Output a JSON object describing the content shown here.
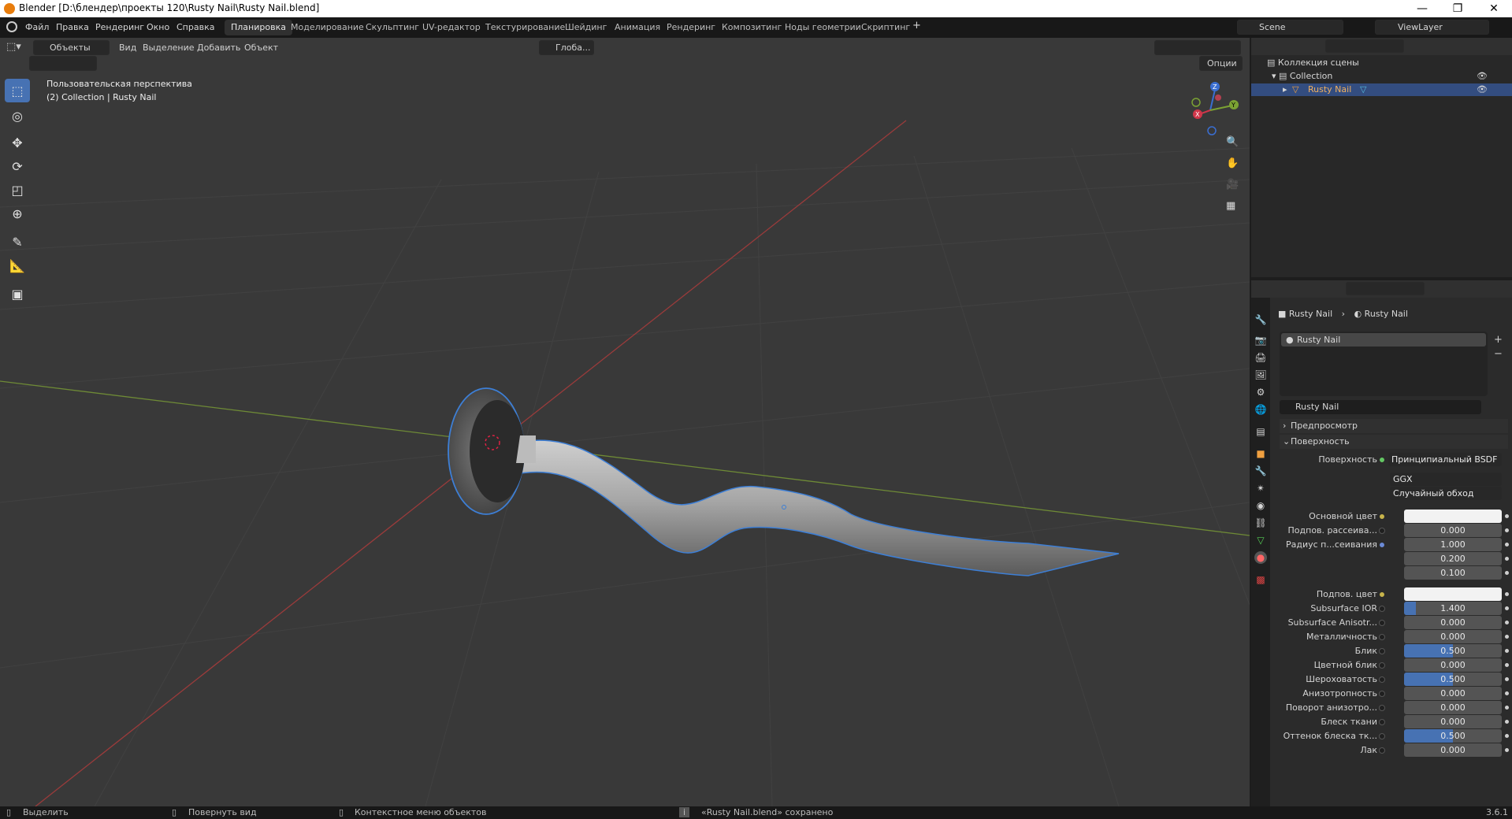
{
  "window": {
    "title": "Blender [D:\\блендер\\проекты 120\\Rusty Nail\\Rusty Nail.blend]",
    "minimize": "—",
    "restore": "❐",
    "close": "✕"
  },
  "menu": [
    "Файл",
    "Правка",
    "Рендеринг",
    "Окно",
    "Справка"
  ],
  "workspaces": [
    "Планировка",
    "Моделирование",
    "Скульптинг",
    "UV-редактор",
    "Текстурирование",
    "Шейдинг",
    "Анимация",
    "Рендеринг",
    "Композитинг",
    "Ноды геометрии",
    "Скриптинг"
  ],
  "active_workspace": "Планировка",
  "scene": {
    "name": "Scene",
    "view_layer": "ViewLayer"
  },
  "viewport": {
    "mode": "Объекты",
    "menus": [
      "Вид",
      "Выделение",
      "Добавить",
      "Объект"
    ],
    "transform_orientation": "Глоба...",
    "options": "Опции",
    "perspective_label": "Пользовательская перспектива",
    "collection_label": "(2) Collection | Rusty Nail",
    "gizmo": {
      "z": "Z",
      "y": "Y",
      "x": "X"
    }
  },
  "outliner": {
    "root": "Коллекция сцены",
    "collection": "Collection",
    "object": "Rusty Nail"
  },
  "properties": {
    "breadcrumb_object": "Rusty Nail",
    "breadcrumb_material": "Rusty Nail",
    "material_slot": "Rusty Nail",
    "material_name": "Rusty Nail",
    "panel_preview": "Предпросмотр",
    "panel_surface": "Поверхность",
    "surface_label": "Поверхность",
    "surface_value": "Принципиальный BSDF",
    "distribution": "GGX",
    "subsurface_method": "Случайный обход",
    "rows": [
      {
        "label": "Основной цвет",
        "value": "",
        "type": "color",
        "dot": "y"
      },
      {
        "label": "Подпов. рассеива...",
        "value": "0.000",
        "fill": 0,
        "dot": "n"
      },
      {
        "label": "Радиус п...сеивания",
        "value": "1.000",
        "fill": 0,
        "dot": "b"
      },
      {
        "label": "",
        "value": "0.200",
        "fill": 0,
        "dot": ""
      },
      {
        "label": "",
        "value": "0.100",
        "fill": 0,
        "dot": ""
      },
      {
        "label": "Подпов. цвет",
        "value": "",
        "type": "color",
        "dot": "y"
      },
      {
        "label": "Subsurface IOR",
        "value": "1.400",
        "fill": 0.12,
        "dot": "n"
      },
      {
        "label": "Subsurface Anisotr...",
        "value": "0.000",
        "fill": 0,
        "dot": "n"
      },
      {
        "label": "Металличность",
        "value": "0.000",
        "fill": 0,
        "dot": "n"
      },
      {
        "label": "Блик",
        "value": "0.500",
        "fill": 0.5,
        "dot": "n"
      },
      {
        "label": "Цветной блик",
        "value": "0.000",
        "fill": 0,
        "dot": "n"
      },
      {
        "label": "Шероховатость",
        "value": "0.500",
        "fill": 0.5,
        "dot": "n"
      },
      {
        "label": "Анизотропность",
        "value": "0.000",
        "fill": 0,
        "dot": "n"
      },
      {
        "label": "Поворот анизотро...",
        "value": "0.000",
        "fill": 0,
        "dot": "n"
      },
      {
        "label": "Блеск ткани",
        "value": "0.000",
        "fill": 0,
        "dot": "n"
      },
      {
        "label": "Оттенок блеска тк...",
        "value": "0.500",
        "fill": 0.5,
        "dot": "n"
      },
      {
        "label": "Лак",
        "value": "0.000",
        "fill": 0,
        "dot": "n"
      }
    ]
  },
  "status": {
    "select": "Выделить",
    "rotate": "Повернуть вид",
    "context": "Контекстное меню объектов",
    "message": "«Rusty Nail.blend» сохранено",
    "version": "3.6.1"
  }
}
